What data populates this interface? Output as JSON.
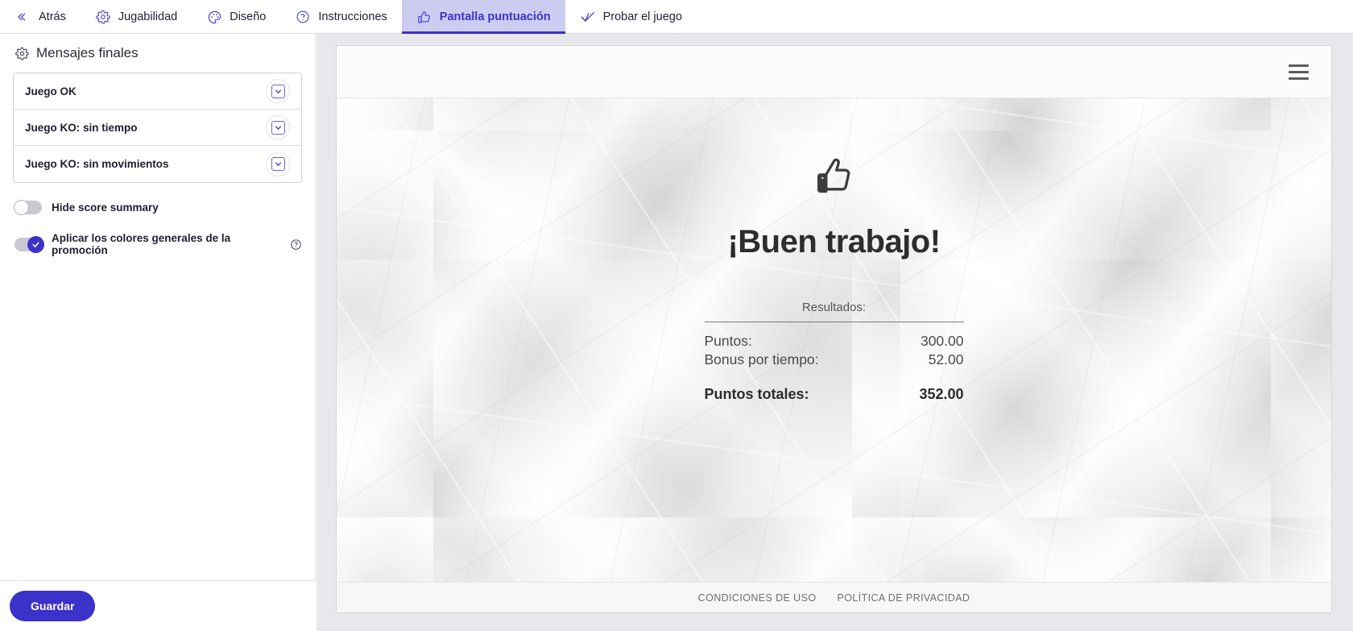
{
  "topnav": {
    "items": [
      {
        "label": "Atrás",
        "icon": "chevrons-left-icon",
        "active": false
      },
      {
        "label": "Jugabilidad",
        "icon": "gear-icon",
        "active": false
      },
      {
        "label": "Diseño",
        "icon": "palette-icon",
        "active": false
      },
      {
        "label": "Instrucciones",
        "icon": "question-circle-icon",
        "active": false
      },
      {
        "label": "Pantalla puntuación",
        "icon": "thumbs-up-icon",
        "active": true
      },
      {
        "label": "Probar el juego",
        "icon": "check-wave-icon",
        "active": false
      }
    ]
  },
  "sidebar": {
    "title": "Mensajes finales",
    "title_icon": "gear-icon",
    "messages": [
      {
        "label": "Juego OK",
        "expand_icon": "chevron-down-icon"
      },
      {
        "label": "Juego KO: sin tiempo",
        "expand_icon": "chevron-down-icon"
      },
      {
        "label": "Juego KO: sin movimientos",
        "expand_icon": "chevron-down-icon"
      }
    ],
    "toggles": [
      {
        "label": "Hide score summary",
        "on": false,
        "help": false
      },
      {
        "label": "Aplicar los colores generales de la promoción",
        "on": true,
        "help": true,
        "help_icon": "question-circle-icon"
      }
    ],
    "save_label": "Guardar"
  },
  "preview": {
    "menu_icon": "hamburger-menu-icon",
    "thumb_icon": "thumbs-up-icon",
    "headline": "¡Buen trabajo!",
    "results_title": "Resultados:",
    "rows": [
      {
        "label": "Puntos:",
        "value": "300.00"
      },
      {
        "label": "Bonus por tiempo:",
        "value": "52.00"
      }
    ],
    "total": {
      "label": "Puntos totales:",
      "value": "352.00"
    },
    "footer_links": [
      "CONDICIONES DE USO",
      "POLÍTICA DE PRIVACIDAD"
    ]
  },
  "colors": {
    "accent": "#3b32c9",
    "active_tab_bg": "#ccccf0",
    "panel_border": "#dcdce4",
    "preview_bg": "#e7e7ec"
  }
}
